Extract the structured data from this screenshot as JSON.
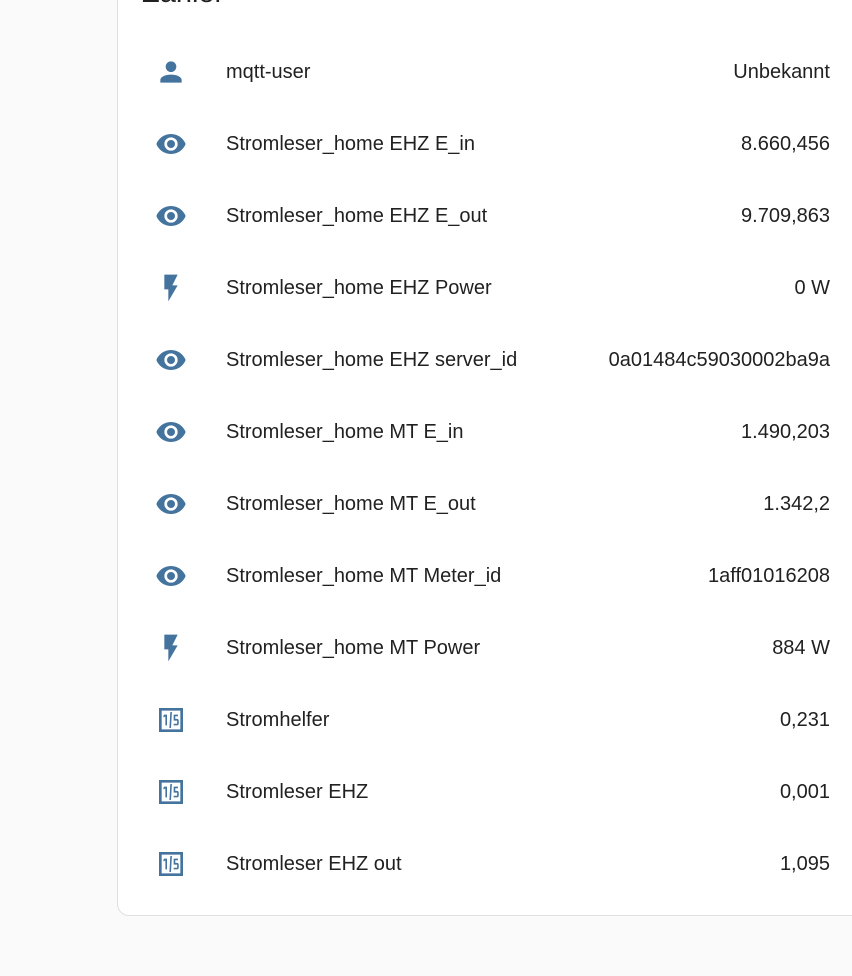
{
  "card": {
    "title": "Zähler",
    "accent_color": "#44739e"
  },
  "entities": [
    {
      "icon": "account-icon",
      "name": "mqtt-user",
      "state": "Unbekannt"
    },
    {
      "icon": "eye-icon",
      "name": "Stromleser_home EHZ E_in",
      "state": "8.660,456"
    },
    {
      "icon": "eye-icon",
      "name": "Stromleser_home EHZ E_out",
      "state": "9.709,863"
    },
    {
      "icon": "flash-icon",
      "name": "Stromleser_home EHZ Power",
      "state": "0 W"
    },
    {
      "icon": "eye-icon",
      "name": "Stromleser_home EHZ server_id",
      "state": "0a01484c59030002ba9a"
    },
    {
      "icon": "eye-icon",
      "name": "Stromleser_home MT E_in",
      "state": "1.490,203"
    },
    {
      "icon": "eye-icon",
      "name": "Stromleser_home MT E_out",
      "state": "1.342,2"
    },
    {
      "icon": "eye-icon",
      "name": "Stromleser_home MT Meter_id",
      "state": "1aff01016208"
    },
    {
      "icon": "flash-icon",
      "name": "Stromleser_home MT Power",
      "state": "884 W"
    },
    {
      "icon": "numeric-box-icon",
      "name": "Stromhelfer",
      "state": "0,231"
    },
    {
      "icon": "numeric-box-icon",
      "name": "Stromleser EHZ",
      "state": "0,001"
    },
    {
      "icon": "numeric-box-icon",
      "name": "Stromleser EHZ out",
      "state": "1,095"
    }
  ]
}
